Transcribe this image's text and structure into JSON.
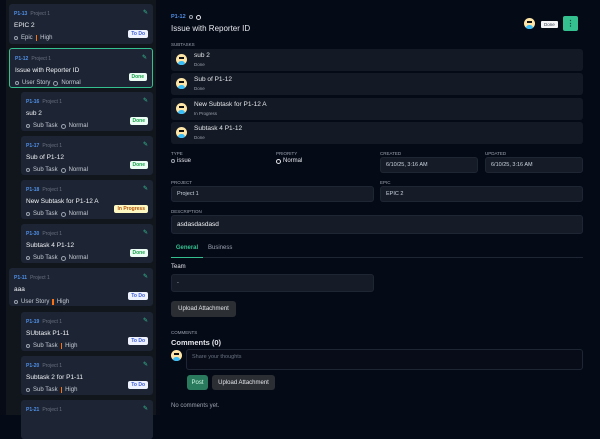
{
  "sidebar": {
    "cards": [
      {
        "id": "P1-13",
        "project": "Project 1",
        "title": "EPIC 2",
        "type": "Epic",
        "priority": "High",
        "status": "To Do"
      },
      {
        "id": "P1-12",
        "project": "Project 1",
        "title": "Issue with Reporter ID",
        "type": "User Story",
        "priority": "Normal",
        "status": "Done"
      },
      {
        "id": "P1-16",
        "project": "Project 1",
        "title": "sub 2",
        "type": "Sub Task",
        "priority": "Normal",
        "status": "Done"
      },
      {
        "id": "P1-17",
        "project": "Project 1",
        "title": "Sub of P1-12",
        "type": "Sub Task",
        "priority": "Normal",
        "status": "Done"
      },
      {
        "id": "P1-18",
        "project": "Project 1",
        "title": "New Subtask for P1-12 A",
        "type": "Sub Task",
        "priority": "Normal",
        "status": "In Progress"
      },
      {
        "id": "P1-30",
        "project": "Project 1",
        "title": "Subtask 4 P1-12",
        "type": "Sub Task",
        "priority": "Normal",
        "status": "Done"
      },
      {
        "id": "P1-11",
        "project": "Project 1",
        "title": "aaa",
        "type": "User Story",
        "priority": "High",
        "status": "To Do"
      },
      {
        "id": "P1-19",
        "project": "Project 1",
        "title": "SUbtask P1-11",
        "type": "Sub Task",
        "priority": "High",
        "status": "To Do"
      },
      {
        "id": "P1-20",
        "project": "Project 1",
        "title": "Subtask 2 for P1-11",
        "type": "Sub Task",
        "priority": "High",
        "status": "To Do"
      },
      {
        "id": "P1-21",
        "project": "Project 1"
      }
    ]
  },
  "detail": {
    "id": "P1-12",
    "title": "Issue with Reporter ID",
    "status": "Done",
    "subtasks_label": "Subtasks",
    "subtasks": [
      {
        "title": "sub 2",
        "status": "Done"
      },
      {
        "title": "Sub of P1-12",
        "status": "Done"
      },
      {
        "title": "New Subtask for P1-12 A",
        "status": "In Progress"
      },
      {
        "title": "Subtask 4 P1-12",
        "status": "Done"
      }
    ],
    "type_label": "Type",
    "type": "issue",
    "priority_label": "Priority",
    "priority": "Normal",
    "created_label": "Created",
    "created": "6/10/25, 3:16 AM",
    "updated_label": "Updated",
    "updated": "6/10/25, 3:16 AM",
    "project_label": "Project",
    "project": "Project 1",
    "epic_label": "Epic",
    "epic": "EPIC 2",
    "description_label": "Description",
    "description": "asdasdasdasd",
    "tabs": [
      "General",
      "Business"
    ],
    "team_label": "Team",
    "team": "-",
    "upload_label": "Upload Attachment",
    "comments_label": "Comments",
    "comments_title": "Comments (0)",
    "comment_placeholder": "Share your thoughts",
    "post_label": "Post",
    "no_comments": "No comments yet."
  },
  "colors": {
    "accent": "#34c08f",
    "link": "#4f8fe6"
  }
}
